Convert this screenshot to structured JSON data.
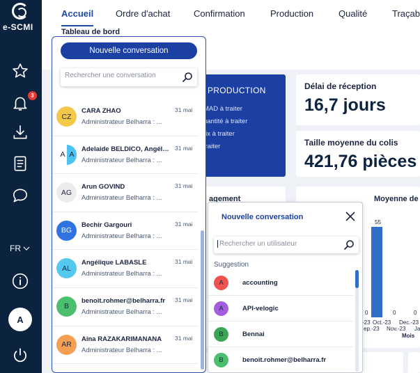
{
  "brand": {
    "logo_text": "e-SCMI"
  },
  "rail": {
    "notification_count": "3",
    "language": "FR",
    "user_initial": "A"
  },
  "nav": {
    "tabs": [
      "Accueil",
      "Ordre d'achat",
      "Confirmation",
      "Production",
      "Qualité",
      "Traçabi"
    ],
    "active": "Accueil",
    "subtitle": "Tableau de bord"
  },
  "production": {
    "title": "PRODUCTION",
    "lines": [
      "MAD à traiter",
      "uantité à traiter",
      "rix à traiter",
      "traiter"
    ]
  },
  "kpis": [
    {
      "label": "Délai de réception",
      "value": "16,7 jours"
    },
    {
      "label": "Taille moyenne du colis",
      "value": "421,76 pièces"
    }
  ],
  "partial_panel_label": "agement",
  "chart_data": {
    "type": "bar",
    "title": "Moyenne de",
    "categories": [
      "Sep.-23",
      "Oct.-23",
      "Nov.-23",
      "Dec.-23",
      "Jan"
    ],
    "tick_labels": [
      "-23",
      "Oct.-23",
      "Dec.-23",
      "ep.-23",
      "Nov.-23",
      "Jan"
    ],
    "values": [
      0,
      55,
      0,
      0,
      0
    ],
    "value_labels": [
      "0",
      "55",
      "0",
      "0",
      "0"
    ],
    "xlabel": "Mois",
    "color": "#2f6fc8"
  },
  "conversations": {
    "new_button": "Nouvelle conversation",
    "search_placeholder": "Rechercher une conversation",
    "items": [
      {
        "initials": "CZ",
        "name": "CARA ZHAO",
        "sub": "Administrateur Belharra : ...",
        "date": "31 mai",
        "color": "#f3c94b"
      },
      {
        "initials": "A",
        "initials2": "A",
        "name": "Adelaide BELDICO, Angéli...",
        "sub": "Administrateur Belharra : ...",
        "date": "31 mai",
        "color": "#ffffff",
        "color2": "#4ec3ef"
      },
      {
        "initials": "AG",
        "name": "Arun GOVIND",
        "sub": "Administrateur Belharra : ...",
        "date": "31 mai",
        "color": "#ececec"
      },
      {
        "initials": "BG",
        "name": "Bechir Gargouri",
        "sub": "Administrateur Belharra : ...",
        "date": "31 mai",
        "color": "#2f73e0"
      },
      {
        "initials": "AL",
        "name": "Angélique LABASLE",
        "sub": "Administrateur Belharra : ...",
        "date": "31 mai",
        "color": "#55c8ef"
      },
      {
        "initials": "B",
        "name": "benoit.rohmer@belharra.fr",
        "sub": "Administrateur Belharra : ...",
        "date": "31 mai",
        "color": "#4cbf6e"
      },
      {
        "initials": "AR",
        "name": "Aina RAZAKARIMANANA",
        "sub": "Administrateur Belharra : ...",
        "date": "31 mai",
        "color": "#f59f55"
      }
    ]
  },
  "new_conversation_popup": {
    "title": "Nouvelle conversation",
    "search_placeholder": "Rechercher un utilisateur",
    "suggestion_label": "Suggestion",
    "suggestions": [
      {
        "initial": "A",
        "name": "accounting",
        "color": "#ef5350"
      },
      {
        "initial": "A",
        "name": "API-velogic",
        "color": "#a55de0"
      },
      {
        "initial": "B",
        "name": "Bennai",
        "color": "#3aa655"
      },
      {
        "initial": "B",
        "name": "benoit.rohmer@belharra.fr",
        "color": "#4cbf6e"
      }
    ]
  }
}
